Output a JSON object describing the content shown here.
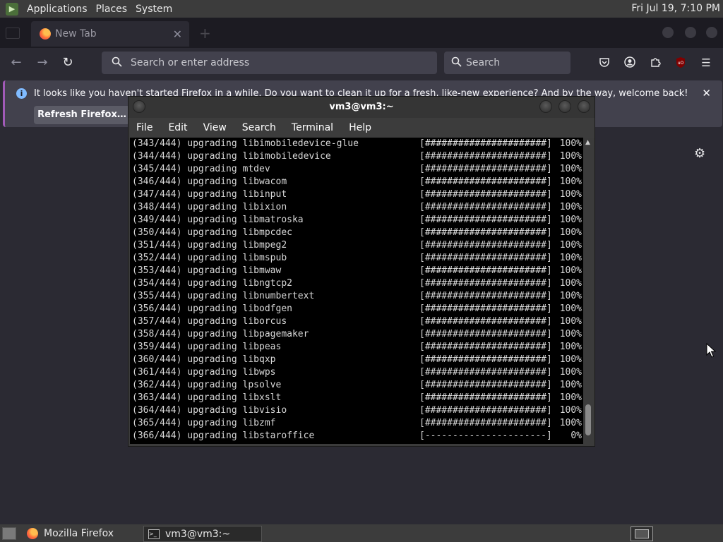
{
  "top_panel": {
    "menus": [
      "Applications",
      "Places",
      "System"
    ],
    "clock": "Fri Jul 19,  7:10 PM"
  },
  "firefox": {
    "tab": {
      "title": "New Tab",
      "close": "✕"
    },
    "urlbar": {
      "placeholder": "Search or enter address"
    },
    "searchbar": {
      "placeholder": "Search"
    },
    "extension_badge": "uO",
    "notification": {
      "message": "It looks like you haven't started Firefox in a while. Do you want to clean it up for a fresh, like-new experience? And by the way, welcome back!",
      "button": "Refresh Firefox…",
      "info": "i"
    }
  },
  "terminal": {
    "title": "vm3@vm3:~",
    "menu": [
      "File",
      "Edit",
      "View",
      "Search",
      "Terminal",
      "Help"
    ],
    "lines": [
      {
        "text": "(343/444) upgrading libimobiledevice-glue",
        "bar": "[######################]",
        "pct": "100%"
      },
      {
        "text": "(344/444) upgrading libimobiledevice",
        "bar": "[######################]",
        "pct": "100%"
      },
      {
        "text": "(345/444) upgrading mtdev",
        "bar": "[######################]",
        "pct": "100%"
      },
      {
        "text": "(346/444) upgrading libwacom",
        "bar": "[######################]",
        "pct": "100%"
      },
      {
        "text": "(347/444) upgrading libinput",
        "bar": "[######################]",
        "pct": "100%"
      },
      {
        "text": "(348/444) upgrading libixion",
        "bar": "[######################]",
        "pct": "100%"
      },
      {
        "text": "(349/444) upgrading libmatroska",
        "bar": "[######################]",
        "pct": "100%"
      },
      {
        "text": "(350/444) upgrading libmpcdec",
        "bar": "[######################]",
        "pct": "100%"
      },
      {
        "text": "(351/444) upgrading libmpeg2",
        "bar": "[######################]",
        "pct": "100%"
      },
      {
        "text": "(352/444) upgrading libmspub",
        "bar": "[######################]",
        "pct": "100%"
      },
      {
        "text": "(353/444) upgrading libmwaw",
        "bar": "[######################]",
        "pct": "100%"
      },
      {
        "text": "(354/444) upgrading libngtcp2",
        "bar": "[######################]",
        "pct": "100%"
      },
      {
        "text": "(355/444) upgrading libnumbertext",
        "bar": "[######################]",
        "pct": "100%"
      },
      {
        "text": "(356/444) upgrading libodfgen",
        "bar": "[######################]",
        "pct": "100%"
      },
      {
        "text": "(357/444) upgrading liborcus",
        "bar": "[######################]",
        "pct": "100%"
      },
      {
        "text": "(358/444) upgrading libpagemaker",
        "bar": "[######################]",
        "pct": "100%"
      },
      {
        "text": "(359/444) upgrading libpeas",
        "bar": "[######################]",
        "pct": "100%"
      },
      {
        "text": "(360/444) upgrading libqxp",
        "bar": "[######################]",
        "pct": "100%"
      },
      {
        "text": "(361/444) upgrading libwps",
        "bar": "[######################]",
        "pct": "100%"
      },
      {
        "text": "(362/444) upgrading lpsolve",
        "bar": "[######################]",
        "pct": "100%"
      },
      {
        "text": "(363/444) upgrading libxslt",
        "bar": "[######################]",
        "pct": "100%"
      },
      {
        "text": "(364/444) upgrading libvisio",
        "bar": "[######################]",
        "pct": "100%"
      },
      {
        "text": "(365/444) upgrading libzmf",
        "bar": "[######################]",
        "pct": "100%"
      },
      {
        "text": "(366/444) upgrading libstaroffice",
        "bar": "[----------------------]",
        "pct": "0%"
      }
    ]
  },
  "taskbar": {
    "tasks": [
      {
        "label": "Mozilla Firefox",
        "active": false
      },
      {
        "label": "vm3@vm3:~",
        "active": true
      }
    ]
  },
  "colors": {
    "firefox_dark": "#2b2a33",
    "tabbar": "#1c1b22",
    "field": "#42414d",
    "notification_accent": "#a15ab8",
    "info_blue": "#80bbff",
    "terminal_bg": "#000000",
    "panel": "#3c3c3c"
  }
}
